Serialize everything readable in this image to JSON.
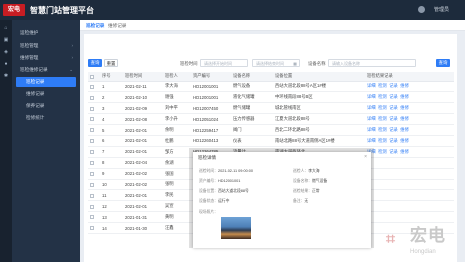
{
  "header": {
    "logo_text": "宏电",
    "app_title": "智慧门站管理平台",
    "user": "管理员"
  },
  "iconbar": {
    "icons": [
      "home-icon",
      "device-icon",
      "map-icon",
      "person-icon",
      "settings-icon"
    ]
  },
  "sidebar": {
    "items": [
      {
        "label": "运检维护",
        "chev": ""
      },
      {
        "label": "巡检管理",
        "chev": "›"
      },
      {
        "label": "维修管理",
        "chev": "›"
      },
      {
        "label": "巡检维修记录",
        "chev": "⌄"
      },
      {
        "label": "巡检记录",
        "chev": ""
      },
      {
        "label": "维修记录",
        "chev": ""
      },
      {
        "label": "保养记录",
        "chev": ""
      },
      {
        "label": "检修统计",
        "chev": ""
      }
    ]
  },
  "tabs": [
    {
      "label": "巡检记录"
    },
    {
      "label": "维修记录"
    }
  ],
  "toolbar": {
    "search_btn": "查询",
    "reset_btn": "重置",
    "date_label": "巡检时间",
    "start_placeholder": "请选择开始时间",
    "end_placeholder": "请选择结束时间",
    "device_label": "设备名称",
    "device_placeholder": "请输入设备名称",
    "export_btn": "查询"
  },
  "table": {
    "headers": [
      "",
      "序号",
      "巡检时间",
      "巡检人",
      "资产编号",
      "设备名称",
      "设备位置",
      "巡检结果记录"
    ],
    "rows": [
      [
        "1",
        "2021-02-11",
        "李大海",
        "HD12001001",
        "燃气设备",
        "西站大道北段88号A区1#楼"
      ],
      [
        "2",
        "2021-02-10",
        "谢强",
        "HD12001001",
        "液化气储罐",
        "中环线南段88号B区"
      ],
      [
        "3",
        "2021-02-09",
        "刘中平",
        "HD12007450",
        "燃气储罐",
        "城北管线南区"
      ],
      [
        "4",
        "2021-02-08",
        "李小升",
        "HD12051024",
        "压力传感器",
        "江夏大道北段88号"
      ],
      [
        "5",
        "2021-02-01",
        "余明",
        "HD12259417",
        "阀门",
        "西北二环北路88号"
      ],
      [
        "6",
        "2021-02-01",
        "杜鹏",
        "HD12260413",
        "仪表",
        "南站北路88号大道南侧A区1#楼"
      ],
      [
        "7",
        "2021-02-01",
        "邹方",
        "HD12264785",
        "流量计",
        "南湖大道西环北"
      ],
      [
        "8",
        "2021-02-04",
        "余湖",
        "",
        "",
        "",
        ""
      ],
      [
        "9",
        "2021-02-02",
        "张国",
        "",
        "",
        "",
        ""
      ],
      [
        "10",
        "2021-02-02",
        "张明",
        "",
        "",
        "",
        ""
      ],
      [
        "11",
        "2021-02-01",
        "李民",
        "",
        "",
        "",
        ""
      ],
      [
        "12",
        "2021-02-01",
        "吴宣",
        "",
        "",
        "",
        ""
      ],
      [
        "13",
        "2021-01-31",
        "黄明",
        "",
        "",
        "",
        ""
      ],
      [
        "14",
        "2021-01-30",
        "汪鑫",
        "",
        "",
        "",
        ""
      ]
    ],
    "ops": [
      "详细",
      "检测",
      "记录",
      "维修"
    ]
  },
  "modal": {
    "title": "巡检详情",
    "close": "×",
    "fields": [
      {
        "k": "巡检时间：",
        "v": "2021-02-11 09:00:00"
      },
      {
        "k": "巡检人：",
        "v": "李大海"
      },
      {
        "k": "资产编号：",
        "v": "HD12001001"
      },
      {
        "k": "设备名称：",
        "v": "燃气设备"
      },
      {
        "k": "设备位置：",
        "v": "西站大道北段88号"
      },
      {
        "k": "巡检结果：",
        "v": "正常"
      },
      {
        "k": "设备状态：",
        "v": "运行中"
      },
      {
        "k": "备注：",
        "v": "无"
      },
      {
        "k": "现场照片：",
        "v": ""
      }
    ]
  },
  "watermark": {
    "cn": "宏电",
    "en": "Hongdian"
  }
}
